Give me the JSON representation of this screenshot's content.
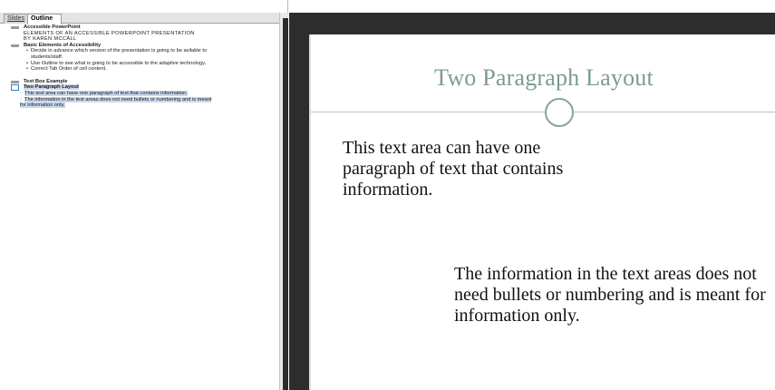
{
  "pane": {
    "tabs": [
      "Slides",
      "Outline"
    ],
    "close_glyph": "×"
  },
  "outline": {
    "slide1": {
      "title": "Accessible PowerPoint",
      "subtitle_lines": [
        "ELEMENTS OF AN ACCESSIBLE POWERPOINT PRESENTATION",
        "BY KAREN MCCALL"
      ]
    },
    "slide2": {
      "title": "Basic Elements of Accessibility",
      "bullets": [
        "Decide in advance which version of the presentation is going to be avilable to",
        "students/staff.",
        "Use Outline to see what is going to be accessible to the adaptive technology.",
        "Correct Tab Order of cell content."
      ]
    },
    "slide3": {
      "title": "Text Box Example"
    },
    "slide4": {
      "title": "Two Paragraph Layout",
      "paragraphs": [
        "This text area can have one paragraph of text that contains information.",
        "The information in the text areas does not need bullets or numbering and is meant",
        "for information only."
      ]
    }
  },
  "slide": {
    "title": "Two Paragraph Layout",
    "body1": "This text area can have one paragraph of text that contains information.",
    "body2": "The information in the text areas does not need bullets or numbering and is meant for information only."
  },
  "colors": {
    "title": "#7d9a97",
    "selection": "#c9d9ee",
    "stage": "#2d2d2d"
  }
}
